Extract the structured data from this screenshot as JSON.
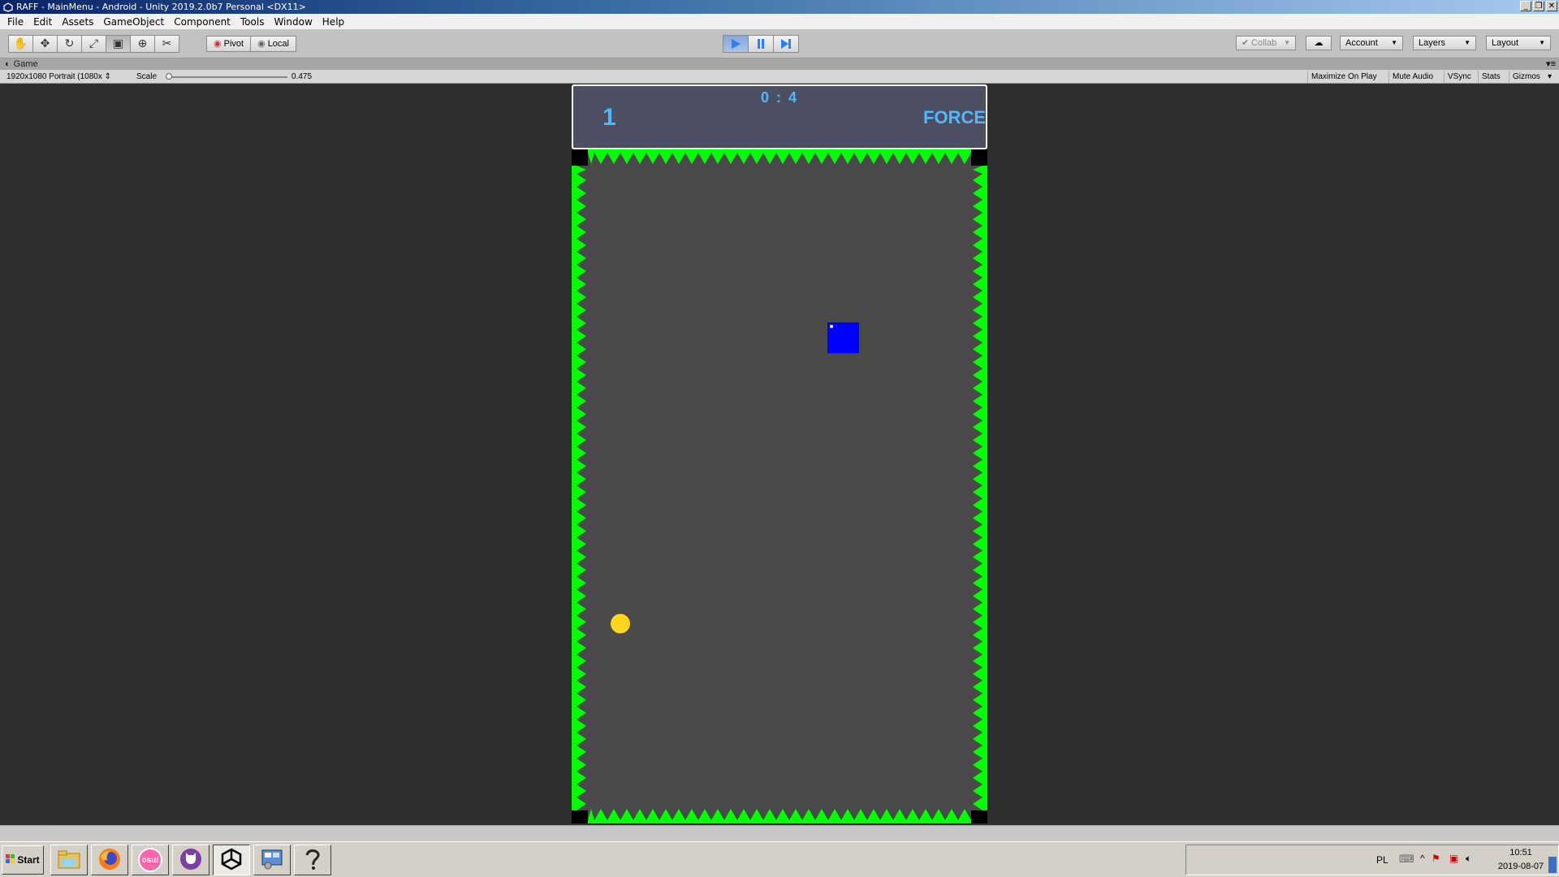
{
  "window": {
    "title": "RAFF - MainMenu - Android - Unity 2019.2.0b7 Personal <DX11>",
    "controls": [
      "minimize",
      "restore",
      "close"
    ]
  },
  "menu": [
    "File",
    "Edit",
    "Assets",
    "GameObject",
    "Component",
    "Tools",
    "Window",
    "Help"
  ],
  "toolbar": {
    "tools": [
      "hand-tool",
      "move-tool",
      "rotate-tool",
      "scale-tool",
      "rect-tool",
      "transform-tool",
      "custom-tool"
    ],
    "pivot_label": "Pivot",
    "local_label": "Local",
    "collab_label": "Collab",
    "account_label": "Account",
    "layers_label": "Layers",
    "layout_label": "Layout",
    "play_state": "playing"
  },
  "game_tab": {
    "label": "Game",
    "resolution": "1920x1080 Portrait (1080x",
    "scale_label": "Scale",
    "scale_value": "0.475",
    "scale_fraction": 0.0,
    "options": [
      "Maximize On Play",
      "Mute Audio",
      "VSync",
      "Stats",
      "Gizmos"
    ]
  },
  "game": {
    "hud": {
      "timer": "0 : 4",
      "score": "1",
      "mode": "FORCE"
    },
    "colors": {
      "hud_bg": "#4c4e61",
      "hud_text": "#4fb8ff",
      "arena_bg": "#4a4a4a",
      "spikes": "#00ff00",
      "player": "#0000ff",
      "coin": "#ffd61e"
    }
  },
  "taskbar": {
    "start_label": "Start",
    "apps": [
      "file-explorer-icon",
      "firefox-icon",
      "osu-icon",
      "cat-app-icon",
      "unity-icon",
      "control-panel-icon",
      "ink-app-icon"
    ],
    "osu_text": "osu!",
    "lang": "PL",
    "time": "10:51",
    "date": "2019-08-07"
  }
}
